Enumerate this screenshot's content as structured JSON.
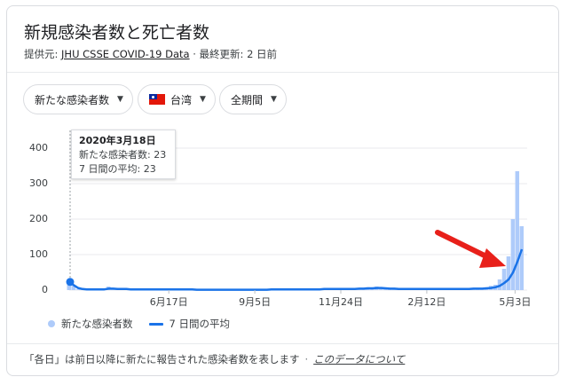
{
  "header": {
    "title": "新規感染者数と死亡者数",
    "source_prefix": "提供元: ",
    "source_link": "JHU CSSE COVID-19 Data",
    "updated": " · 最終更新: 2 日前"
  },
  "filters": {
    "metric": "新たな感染者数",
    "region": "台湾",
    "period": "全期間"
  },
  "tooltip": {
    "date": "2020年3月18日",
    "new_cases": "新たな感染者数: 23",
    "avg": "7 日間の平均: 23"
  },
  "legend": {
    "bars": "新たな感染者数",
    "line": "7 日間の平均"
  },
  "footer": {
    "note": "「各日」は前日以降に新たに報告された感染者数を表します",
    "link": "このデータについて"
  },
  "colors": {
    "bars": "#aecbfa",
    "line": "#1a73e8",
    "arrow": "#e8201a"
  },
  "chart_data": {
    "type": "bar",
    "title": "",
    "xlabel": "",
    "ylabel": "",
    "ylim": [
      0,
      400
    ],
    "yticks": [
      0,
      100,
      200,
      300,
      400
    ],
    "x_tick_labels": [
      "6月17日",
      "9月5日",
      "11月24日",
      "2月12日",
      "5月3日"
    ],
    "series": [
      {
        "name": "新たな感染者数",
        "type": "bar",
        "values": [
          23,
          12,
          2,
          1,
          3,
          2,
          1,
          4,
          2,
          10,
          3,
          2,
          1,
          5,
          1,
          2,
          3,
          1,
          2,
          4,
          1,
          3,
          2,
          1,
          1,
          2,
          3,
          1,
          2,
          1,
          1,
          2,
          1,
          0,
          1,
          2,
          1,
          0,
          1,
          2,
          1,
          1,
          0,
          1,
          2,
          1,
          3,
          1,
          2,
          1,
          1,
          2,
          1,
          3,
          2,
          1,
          4,
          2,
          3,
          1,
          2,
          5,
          3,
          2,
          4,
          1,
          6,
          3,
          8,
          5,
          10,
          6,
          4,
          3,
          5,
          2,
          4,
          3,
          2,
          5,
          3,
          1,
          2,
          4,
          3,
          2,
          5,
          3,
          4,
          2,
          3,
          5,
          4,
          3,
          6,
          8,
          12,
          15,
          30,
          60,
          95,
          200,
          335,
          180
        ]
      },
      {
        "name": "7 日間の平均",
        "type": "line",
        "values": [
          23,
          14,
          6,
          3,
          2,
          2,
          2,
          2,
          2,
          4,
          4,
          3,
          3,
          3,
          2,
          2,
          2,
          2,
          2,
          2,
          2,
          2,
          2,
          2,
          2,
          2,
          2,
          2,
          2,
          1,
          1,
          1,
          1,
          1,
          1,
          1,
          1,
          1,
          1,
          1,
          1,
          1,
          1,
          1,
          1,
          1,
          2,
          2,
          2,
          2,
          2,
          2,
          2,
          2,
          2,
          2,
          2,
          2,
          3,
          3,
          3,
          3,
          3,
          3,
          3,
          3,
          4,
          4,
          5,
          5,
          6,
          6,
          5,
          4,
          4,
          3,
          3,
          3,
          3,
          3,
          3,
          3,
          3,
          3,
          3,
          3,
          3,
          3,
          3,
          3,
          3,
          3,
          4,
          4,
          4,
          5,
          6,
          8,
          12,
          20,
          30,
          50,
          80,
          115
        ]
      }
    ]
  }
}
